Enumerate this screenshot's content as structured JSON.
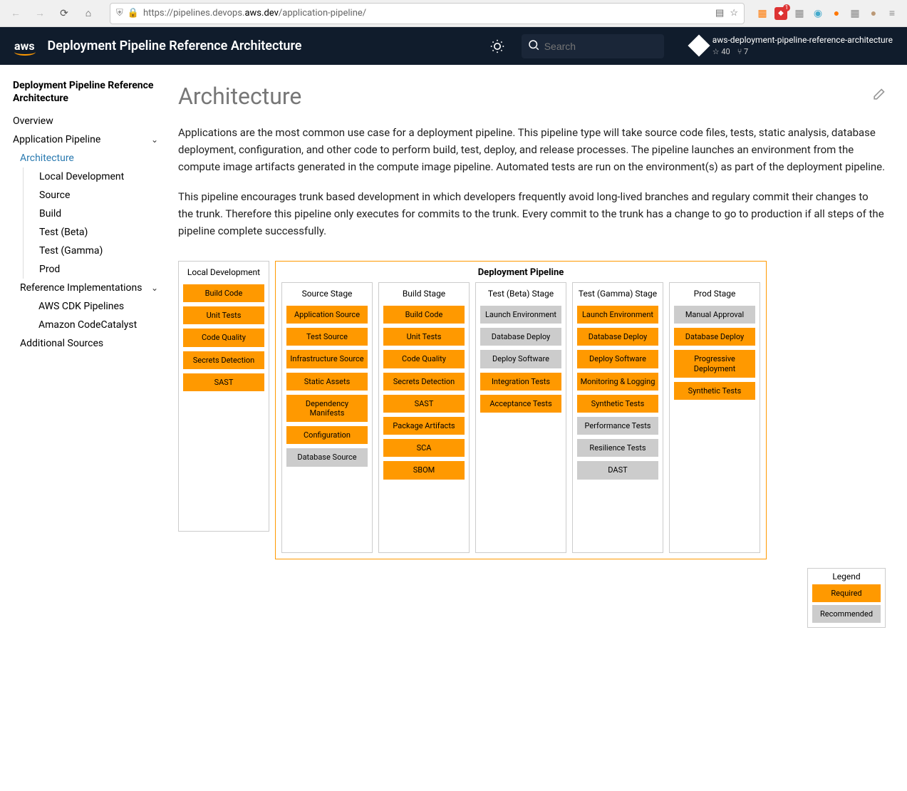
{
  "browser": {
    "url_prefix": "https://pipelines.devops.",
    "url_domain": "aws.dev",
    "url_path": "/application-pipeline/"
  },
  "header": {
    "logo_text": "aws",
    "title": "Deployment Pipeline Reference Architecture",
    "search_placeholder": "Search",
    "repo_name": "aws-deployment-pipeline-reference-architecture",
    "stars": "40",
    "forks": "7"
  },
  "sidebar": {
    "section_title": "Deployment Pipeline Reference Architecture",
    "items": {
      "overview": "Overview",
      "app_pipeline": "Application Pipeline",
      "architecture": "Architecture",
      "local_dev": "Local Development",
      "source": "Source",
      "build": "Build",
      "test_beta": "Test (Beta)",
      "test_gamma": "Test (Gamma)",
      "prod": "Prod",
      "ref_impl": "Reference Implementations",
      "cdk": "AWS CDK Pipelines",
      "codecat": "Amazon CodeCatalyst",
      "addl": "Additional Sources"
    }
  },
  "content": {
    "title": "Architecture",
    "para1": "Applications are the most common use case for a deployment pipeline. This pipeline type will take source code files, tests, static analysis, database deployment, configuration, and other code to perform build, test, deploy, and release processes. The pipeline launches an environment from the compute image artifacts generated in the compute image pipeline. Automated tests are run on the environment(s) as part of the deployment pipeline.",
    "para2": "This pipeline encourages trunk based development in which developers frequently avoid long-lived branches and regulary commit their changes to the trunk. Therefore this pipeline only executes for commits to the trunk. Every commit to the trunk has a change to go to production if all steps of the pipeline complete successfully."
  },
  "diagram": {
    "deploy_title": "Deployment Pipeline",
    "local": {
      "title": "Local Development",
      "steps": [
        {
          "label": "Build Code",
          "type": "required"
        },
        {
          "label": "Unit Tests",
          "type": "required"
        },
        {
          "label": "Code Quality",
          "type": "required"
        },
        {
          "label": "Secrets Detection",
          "type": "required"
        },
        {
          "label": "SAST",
          "type": "required"
        }
      ]
    },
    "source": {
      "title": "Source Stage",
      "steps": [
        {
          "label": "Application Source",
          "type": "required"
        },
        {
          "label": "Test Source",
          "type": "required"
        },
        {
          "label": "Infrastructure Source",
          "type": "required"
        },
        {
          "label": "Static Assets",
          "type": "required"
        },
        {
          "label": "Dependency Manifests",
          "type": "required"
        },
        {
          "label": "Configuration",
          "type": "required"
        },
        {
          "label": "Database Source",
          "type": "recommended"
        }
      ]
    },
    "build": {
      "title": "Build Stage",
      "steps": [
        {
          "label": "Build Code",
          "type": "required"
        },
        {
          "label": "Unit Tests",
          "type": "required"
        },
        {
          "label": "Code Quality",
          "type": "required"
        },
        {
          "label": "Secrets Detection",
          "type": "required"
        },
        {
          "label": "SAST",
          "type": "required"
        },
        {
          "label": "Package Artifacts",
          "type": "required"
        },
        {
          "label": "SCA",
          "type": "required"
        },
        {
          "label": "SBOM",
          "type": "required"
        }
      ]
    },
    "beta": {
      "title": "Test (Beta) Stage",
      "steps": [
        {
          "label": "Launch Environment",
          "type": "recommended"
        },
        {
          "label": "Database Deploy",
          "type": "recommended"
        },
        {
          "label": "Deploy Software",
          "type": "recommended"
        },
        {
          "label": "Integration Tests",
          "type": "required"
        },
        {
          "label": "Acceptance Tests",
          "type": "required"
        }
      ]
    },
    "gamma": {
      "title": "Test (Gamma) Stage",
      "steps": [
        {
          "label": "Launch Environment",
          "type": "required"
        },
        {
          "label": "Database Deploy",
          "type": "required"
        },
        {
          "label": "Deploy Software",
          "type": "required"
        },
        {
          "label": "Monitoring & Logging",
          "type": "required"
        },
        {
          "label": "Synthetic Tests",
          "type": "required"
        },
        {
          "label": "Performance Tests",
          "type": "recommended"
        },
        {
          "label": "Resilience Tests",
          "type": "recommended"
        },
        {
          "label": "DAST",
          "type": "recommended"
        }
      ]
    },
    "prod": {
      "title": "Prod Stage",
      "steps": [
        {
          "label": "Manual Approval",
          "type": "recommended"
        },
        {
          "label": "Database Deploy",
          "type": "required"
        },
        {
          "label": "Progressive Deployment",
          "type": "required"
        },
        {
          "label": "Synthetic Tests",
          "type": "required"
        }
      ]
    }
  },
  "legend": {
    "title": "Legend",
    "required": "Required",
    "recommended": "Recommended"
  }
}
